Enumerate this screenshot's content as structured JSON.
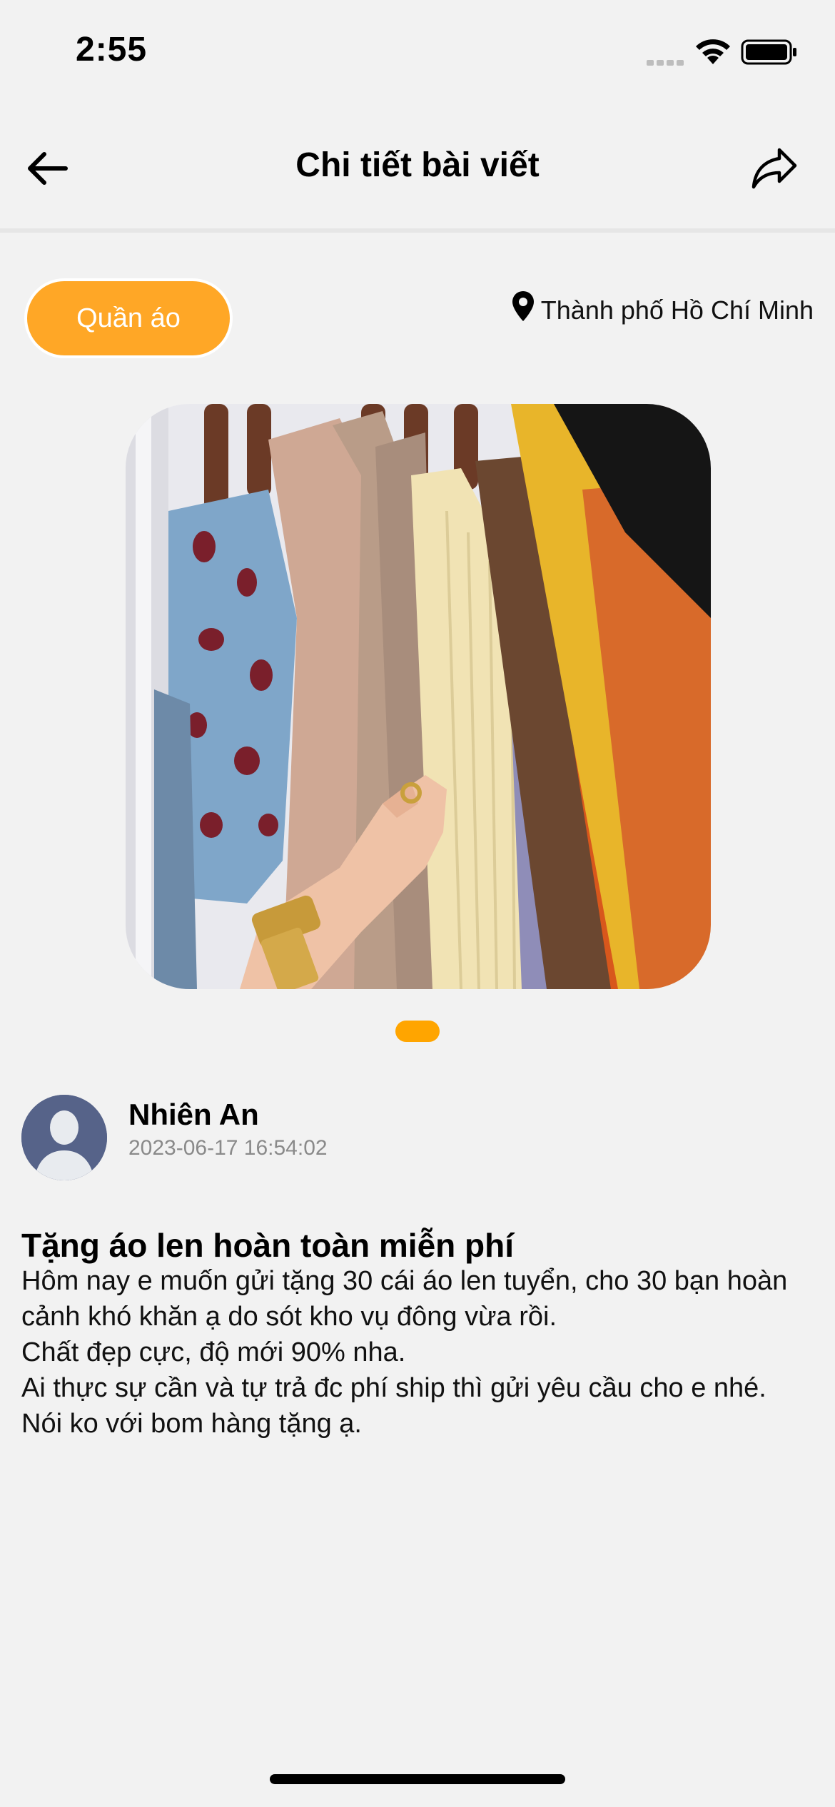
{
  "status_bar": {
    "time": "2:55",
    "icons": [
      "cellular-signal-icon",
      "wifi-icon",
      "battery-icon"
    ]
  },
  "nav": {
    "title": "Chi tiết bài viết",
    "back_icon": "arrow-left-icon",
    "share_icon": "share-icon"
  },
  "post": {
    "category": "Quần áo",
    "location": "Thành phố Hồ Chí Minh",
    "image": "clothes-rack-photo",
    "pager": {
      "current": 1,
      "total": 1
    },
    "author": {
      "name": "Nhiên An",
      "timestamp": "2023-06-17 16:54:02"
    },
    "title": "Tặng áo len hoàn toàn miễn phí",
    "body": "Hôm nay e muốn gửi tặng 30 cái áo len tuyển, cho 30 bạn hoàn cảnh khó khăn ạ do sót kho vụ đông vừa rồi.\nChất đẹp cực, độ mới 90% nha.\nAi thực sự cần và tự trả đc phí ship thì gửi yêu cầu cho e nhé.\nNói ko với bom hàng tặng ạ."
  },
  "colors": {
    "accent": "#ffa726",
    "background": "#f2f2f2",
    "muted_text": "#8a8a8a"
  }
}
